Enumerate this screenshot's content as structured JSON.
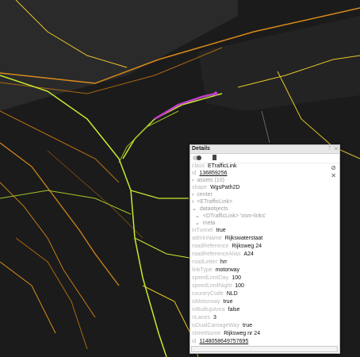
{
  "colors": {
    "background": "#1b1b1b",
    "selected": "#c13ec8",
    "motorway": "#c6ea2f",
    "primary": "#d98a1a",
    "secondary": "#e8c62c"
  },
  "panel": {
    "title": "Details",
    "header_icons": [
      "pin-icon",
      "collapse-icon"
    ],
    "side_icons": [
      "clear-selection-icon",
      "close-icon"
    ],
    "class_key": "class",
    "class_value": "ETrafficLink",
    "id_key": "id",
    "id_value": "136859256",
    "assets_label": "assets (10)",
    "shape_key": "shape",
    "shape_value": "WgsPath2D",
    "center_label": "center",
    "type_label": "<ETrafficLink>",
    "dataobjects_label": "dataobjects",
    "subobject_label": "<DTrafficLink> 'osm-links'",
    "meta_label": "meta",
    "fields": [
      {
        "key": "inTunnel",
        "value": "true"
      },
      {
        "key": "adminName",
        "value": "Rijkswaterstaat"
      },
      {
        "key": "roadReference",
        "value": "Rijksweg 24"
      },
      {
        "key": "roadReferenceAlias",
        "value": "A24"
      },
      {
        "key": "roadLetter",
        "value": "hrr"
      },
      {
        "key": "linkType",
        "value": "motorway"
      },
      {
        "key": "speedLimitDay",
        "value": "100"
      },
      {
        "key": "speedLimitNight",
        "value": "100"
      },
      {
        "key": "countryCode",
        "value": "NLD"
      },
      {
        "key": "isMotorway",
        "value": "true"
      },
      {
        "key": "inBuiltupArea",
        "value": "false"
      },
      {
        "key": "nLanes",
        "value": "3"
      },
      {
        "key": "isDualCarriageWay",
        "value": "true"
      },
      {
        "key": "streetName",
        "value": "Rijksweg nr 24"
      },
      {
        "key": "id",
        "value": "1148058649757695"
      }
    ]
  }
}
